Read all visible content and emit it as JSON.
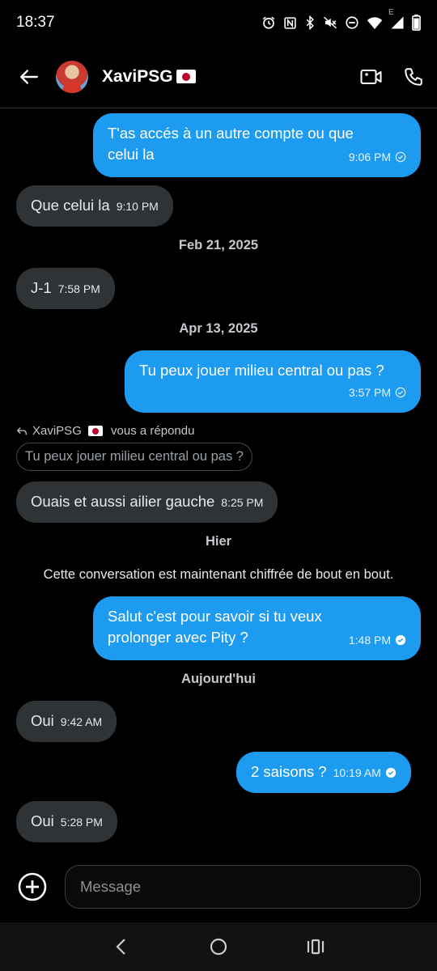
{
  "status": {
    "time": "18:37",
    "icons": [
      "alarm-icon",
      "nfc-icon",
      "bluetooth-icon",
      "mute-icon",
      "dnd-icon",
      "wifi-icon",
      "signal-icon",
      "battery-icon"
    ],
    "network_letter": "E"
  },
  "header": {
    "contact_name": "XaviPSG",
    "contact_flag": "flag-japan-icon"
  },
  "messages": [
    {
      "dir": "out",
      "text": "T'as accés à un autre compte ou que\ncelui la",
      "time": "9:06 PM",
      "read": false
    },
    {
      "dir": "in",
      "text": "Que celui la",
      "time": "9:10 PM"
    },
    {
      "dir": "in",
      "text": "J-1",
      "time": "7:58 PM"
    },
    {
      "dir": "out",
      "text": "Tu peux jouer milieu central ou pas ?",
      "time": "3:57 PM",
      "read": false
    },
    {
      "dir": "in",
      "text": "Ouais et aussi ailier gauche",
      "time": "8:25 PM"
    },
    {
      "dir": "out",
      "text": "Salut c'est pour savoir si tu veux\nprolonger avec Pity ?",
      "time": "1:48 PM",
      "read": true
    },
    {
      "dir": "in",
      "text": "Oui",
      "time": "9:42 AM"
    },
    {
      "dir": "out",
      "text": "2 saisons ?",
      "time": "10:19 AM",
      "read": true
    },
    {
      "dir": "in",
      "text": "Oui",
      "time": "5:28 PM"
    }
  ],
  "separators": {
    "feb": "Feb 21, 2025",
    "apr": "Apr 13, 2025",
    "hier": "Hier",
    "today": "Aujourd'hui"
  },
  "notice": "Cette conversation est maintenant chiffrée de bout en bout.",
  "reply": {
    "who": "XaviPSG",
    "suffix": " vous a répondu",
    "quote": "Tu peux jouer milieu central ou pas ?"
  },
  "composer": {
    "placeholder": "Message"
  },
  "colors": {
    "outgoing_bubble": "#1d9bf0",
    "incoming_bubble": "#2f3336",
    "background": "#000000"
  }
}
